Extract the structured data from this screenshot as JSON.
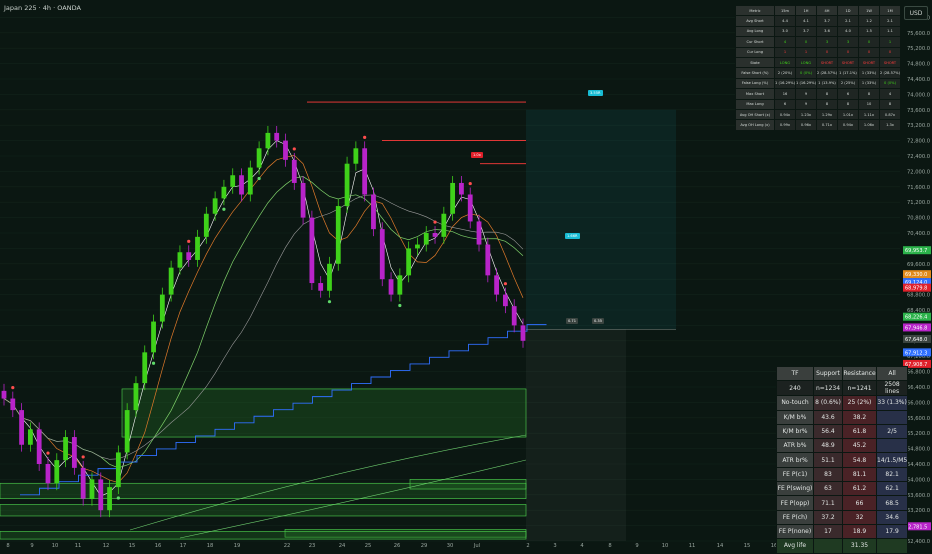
{
  "header": {
    "title": "Japan 225 · 4h · OANDA",
    "currency": "USD"
  },
  "colors": {
    "bg": "#0b1712",
    "up": "#3fd11a",
    "down": "#b824c9",
    "res": "#ff3b3b",
    "sup": "#4ad24a",
    "blue": "#2f6fff",
    "zone": "#2a8a2a",
    "cyan": "#18bcd4"
  },
  "chart_data": {
    "type": "line",
    "title": "Japan 225 · 4h · OANDA",
    "xlabel": "",
    "ylabel": "",
    "ylim": [
      62400,
      76400
    ],
    "x_ticks": [
      "8",
      "9",
      "10",
      "11",
      "12",
      "15",
      "16",
      "17",
      "18",
      "19",
      "22",
      "23",
      "24",
      "25",
      "26",
      "29",
      "30",
      "Jul",
      "2",
      "3",
      "4",
      "8",
      "9",
      "10",
      "11",
      "14",
      "15",
      "16",
      "17",
      "20",
      "21",
      "22"
    ],
    "y_ticks": [
      62400,
      62800,
      63200,
      63600,
      64000,
      64400,
      64800,
      65200,
      65600,
      66000,
      66400,
      66800,
      67200,
      67600,
      68000,
      68400,
      68800,
      69200,
      69600,
      70000,
      70400,
      70800,
      71200,
      71600,
      72000,
      72400,
      72800,
      73200,
      73600,
      74000,
      74400,
      74800,
      75200,
      75600,
      76000
    ],
    "series": [
      {
        "values": [
          66100,
          65800,
          64900,
          65300,
          64400,
          63900,
          64500,
          65100,
          64300,
          63500,
          64000,
          63200,
          63800,
          64700,
          65800,
          66500,
          67300,
          68100,
          68800,
          69500,
          69900,
          69700,
          70300,
          70900,
          71300,
          71600,
          71900,
          71400,
          72100,
          72600,
          73000,
          72800,
          72300,
          71700,
          70800,
          69100,
          68900,
          69600,
          71100,
          72200,
          72600,
          71400,
          70500,
          69200,
          68800,
          69300,
          70000,
          70100,
          70400,
          70300,
          70900,
          71700,
          71400,
          70700,
          70100,
          69300,
          68800,
          68500,
          68000,
          67600
        ]
      }
    ],
    "price_labels": [
      "69,953.7",
      "69,330.0",
      "69,124.0",
      "68,979.8",
      "68,226.4",
      "67,946.8",
      "67,648.0",
      "67,912.3",
      "67,908.7",
      "62,781.5"
    ],
    "labels": [
      "3.55R",
      "1.66R",
      "1.0x",
      "0.71",
      "0.35"
    ]
  },
  "metrics_table": {
    "header": [
      "Metric",
      "15m",
      "1H",
      "4H",
      "1D",
      "1W",
      "1M"
    ],
    "rows": [
      [
        "Avg Short",
        "4.4",
        "4.1",
        "3.7",
        "2.1",
        "1.2",
        "2.1"
      ],
      [
        "Avg Long",
        "3.0",
        "3.7",
        "3.6",
        "4.0",
        "1.5",
        "1.1"
      ],
      [
        "Cur Short",
        "4",
        "0",
        "3",
        "3",
        "0",
        "1"
      ],
      [
        "Cur Long",
        "1",
        "1",
        "0",
        "0",
        "0",
        "0"
      ],
      [
        "State",
        "LONG",
        "LONG",
        "SHORT",
        "SHORT",
        "SHORT",
        "SHORT"
      ],
      [
        "False Short (%)",
        "2 (20%)",
        "0 (0%)",
        "2 (28.57%)",
        "1 (17.1%)",
        "1 (33%)",
        "2 (28.57%)"
      ],
      [
        "False Long (%)",
        "1 (16.29%)",
        "1 (16.29%)",
        "1 (13.9%)",
        "2 (25%)",
        "1 (33%)",
        "0 (0%)"
      ],
      [
        "Max Short",
        "16",
        "9",
        "8",
        "6",
        "8",
        "4"
      ],
      [
        "Max Long",
        "6",
        "9",
        "8",
        "8",
        "10",
        "8"
      ],
      [
        "Avg OH Short (x)",
        "0.94x",
        "1.23x",
        "1.29x",
        "1.01x",
        "1.11x",
        "0.87x"
      ],
      [
        "Avg OH Long (x)",
        "0.99x",
        "0.96x",
        "0.71x",
        "0.94x",
        "1.06x",
        "1.3x"
      ]
    ]
  },
  "fe_table": {
    "header": [
      "TF",
      "Support",
      "Resistance",
      "All"
    ],
    "rows": [
      [
        "240",
        "n=1234",
        "n=1241",
        "2508 lines"
      ],
      [
        "No-touch",
        "8 (0.6%)",
        "25 (2%)",
        "33 (1.3%)"
      ],
      [
        "K/M b%",
        "43.6",
        "38.2",
        ""
      ],
      [
        "K/M br%",
        "56.4",
        "61.8",
        "2/5"
      ],
      [
        "ATR b%",
        "48.9",
        "45.2",
        ""
      ],
      [
        "ATR br%",
        "51.1",
        "54.8",
        "14/1.5/M5"
      ],
      [
        "FE P(c1)",
        "83",
        "81.1",
        "82.1"
      ],
      [
        "FE P(swing)",
        "63",
        "61.2",
        "62.1"
      ],
      [
        "FE P(opp)",
        "71.1",
        "66",
        "68.5"
      ],
      [
        "FE P(ch)",
        "37.2",
        "32",
        "34.6"
      ],
      [
        "FE P(none)",
        "17",
        "18.9",
        "17.9"
      ],
      [
        "Avg life",
        "",
        "31.35",
        ""
      ]
    ]
  }
}
